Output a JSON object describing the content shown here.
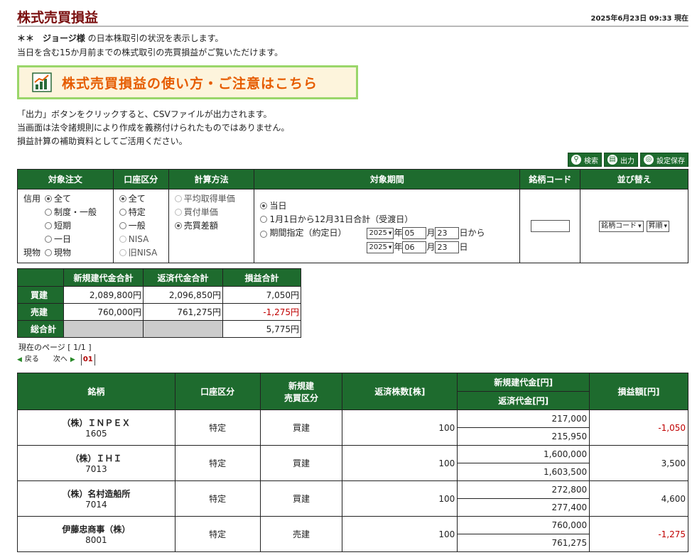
{
  "header": {
    "title": "株式売買損益",
    "timestamp": "2025年6月23日 09:33 現在"
  },
  "intro": {
    "prefix": "＊＊　",
    "name": "ジョージ様",
    "line1_rest": " の日本株取引の状況を表示します。",
    "line2": "当日を含む15か月前までの株式取引の売買損益がご覧いただけます。"
  },
  "banner": {
    "text": "株式売買損益の使い方・ご注意はこちら"
  },
  "notes": [
    "「出力」ボタンをクリックすると、CSVファイルが出力されます。",
    "当画面は法令諸規則により作成を義務付けられたものではありません。",
    "損益計算の補助資料としてご活用ください。"
  ],
  "toolbar": {
    "search": "検索",
    "output": "出力",
    "save": "設定保存"
  },
  "filter": {
    "headers": [
      "対象注文",
      "口座区分",
      "計算方法",
      "対象期間",
      "銘柄コード",
      "並び替え"
    ],
    "order": {
      "credit_label": "信用",
      "spot_label": "現物",
      "opts": [
        "全て",
        "制度・一般",
        "短期",
        "一日",
        "現物"
      ]
    },
    "account": {
      "opts": [
        "全て",
        "特定",
        "一般",
        "NISA",
        "旧NISA"
      ]
    },
    "calc": {
      "opts": [
        "平均取得単価",
        "買付単価",
        "売買差額"
      ]
    },
    "period": {
      "opt_today": "当日",
      "opt_year": "1月1日から12月31日合計（受渡日）",
      "opt_range": "期間指定（約定日）",
      "from_year": "2025",
      "from_month": "05",
      "from_day": "23",
      "to_year": "2025",
      "to_month": "06",
      "to_day": "23",
      "year_unit": "年",
      "month_unit": "月",
      "day_from": "日から",
      "day_unit": "日"
    },
    "code_value": "",
    "sort": {
      "field": "銘柄コード",
      "order": "昇順"
    }
  },
  "summary": {
    "headers": [
      "新規建代金合計",
      "返済代金合計",
      "損益合計"
    ],
    "rows": [
      {
        "label": "買建",
        "new": "2,089,800円",
        "repay": "2,096,850円",
        "pl": "7,050円"
      },
      {
        "label": "売建",
        "new": "760,000円",
        "repay": "761,275円",
        "pl": "-1,275円"
      }
    ],
    "total_label": "総合計",
    "total_pl": "5,775円"
  },
  "pager": {
    "current": "現在のページ [ 1/1 ]",
    "prev": "戻る",
    "next": "次へ",
    "page": "01"
  },
  "main": {
    "headers": {
      "stock": "銘柄",
      "account": "口座区分",
      "type_line1": "新規建",
      "type_line2": "売買区分",
      "qty": "返済株数[株]",
      "new_amount": "新規建代金[円]",
      "repay_amount": "返済代金[円]",
      "pl": "損益額[円]"
    },
    "rows": [
      {
        "name": "（株）ＩＮＰＥＸ",
        "code": "1605",
        "account": "特定",
        "type": "買建",
        "qty": "100",
        "new": "217,000",
        "repay": "215,950",
        "pl": "-1,050"
      },
      {
        "name": "（株）ＩＨＩ",
        "code": "7013",
        "account": "特定",
        "type": "買建",
        "qty": "100",
        "new": "1,600,000",
        "repay": "1,603,500",
        "pl": "3,500"
      },
      {
        "name": "（株）名村造船所",
        "code": "7014",
        "account": "特定",
        "type": "買建",
        "qty": "100",
        "new": "272,800",
        "repay": "277,400",
        "pl": "4,600"
      },
      {
        "name": "伊藤忠商事（株）",
        "code": "8001",
        "account": "特定",
        "type": "売建",
        "qty": "100",
        "new": "760,000",
        "repay": "761,275",
        "pl": "-1,275"
      }
    ]
  },
  "colors": {
    "header_green": "#1e6b2e",
    "title_red": "#7a0f0f",
    "banner_orange": "#e65c00",
    "negative": "#c00000"
  }
}
